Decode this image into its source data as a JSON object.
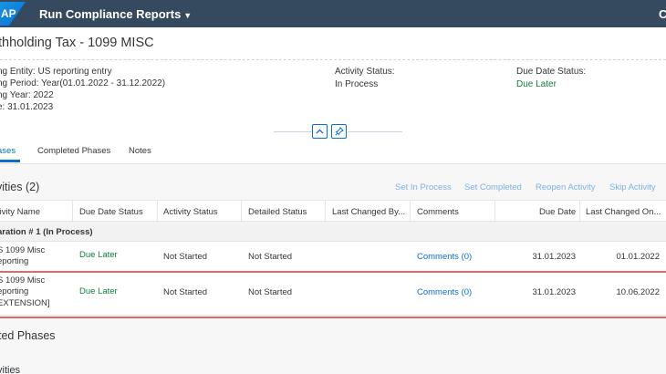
{
  "shell": {
    "logo_text": "AP",
    "app_title": "Run Compliance Reports",
    "right_glyph": "C"
  },
  "header": {
    "title": "thholding Tax - 1099 MISC",
    "attributes_left": [
      "ng Entity: US reporting entry",
      "ng Period: Year(01.01.2022 - 31.12.2022)",
      "ng Year: 2022",
      "e: 31.01.2023"
    ],
    "activity_status_label": "Activity Status:",
    "activity_status_value": "In Process",
    "due_date_status_label": "Due Date Status:",
    "due_date_status_value": "Due Later"
  },
  "tabs": [
    {
      "label": "ases",
      "selected": true
    },
    {
      "label": "Completed Phases",
      "selected": false
    },
    {
      "label": "Notes",
      "selected": false
    }
  ],
  "activities": {
    "title": "vities (2)",
    "toolbar": {
      "set_in_process": "Set In Process",
      "set_completed": "Set Completed",
      "reopen_activity": "Reopen Activity",
      "skip_activity": "Skip Activity"
    },
    "columns": {
      "activity_name": "tivity Name",
      "due_date_status": "Due Date Status",
      "activity_status": "Activity Status",
      "detailed_status": "Detailed Status",
      "last_changed_by": "Last Changed By...",
      "comments": "Comments",
      "due_date": "Due Date",
      "last_changed_on": "Last Changed On..."
    },
    "group_label": "aration # 1 (In Process)",
    "rows": [
      {
        "name_lines": [
          "S 1099 Misc",
          "eporting"
        ],
        "due_date_status": "Due Later",
        "activity_status": "Not Started",
        "detailed_status": "Not Started",
        "comments": "Comments (0)",
        "due_date": "31.01.2023",
        "last_changed_on": "01.01.2022"
      },
      {
        "name_lines": [
          "S 1099 Misc",
          "eporting",
          "EXTENSION]"
        ],
        "due_date_status": "Due Later",
        "activity_status": "Not Started",
        "detailed_status": "Not Started",
        "comments": "Comments (0)",
        "due_date": "31.01.2023",
        "last_changed_on": "10.06.2022"
      }
    ]
  },
  "completed_section": {
    "title": "ted Phases",
    "subtitle": "vities"
  },
  "colors": {
    "shell_bg": "#354a5f",
    "accent": "#0a6ed1",
    "positive": "#107e3e",
    "highlight": "#e0696f"
  },
  "icons": {
    "collapse": "chevron-up-icon",
    "pin": "pin-icon",
    "menu": "caret-down-icon"
  }
}
